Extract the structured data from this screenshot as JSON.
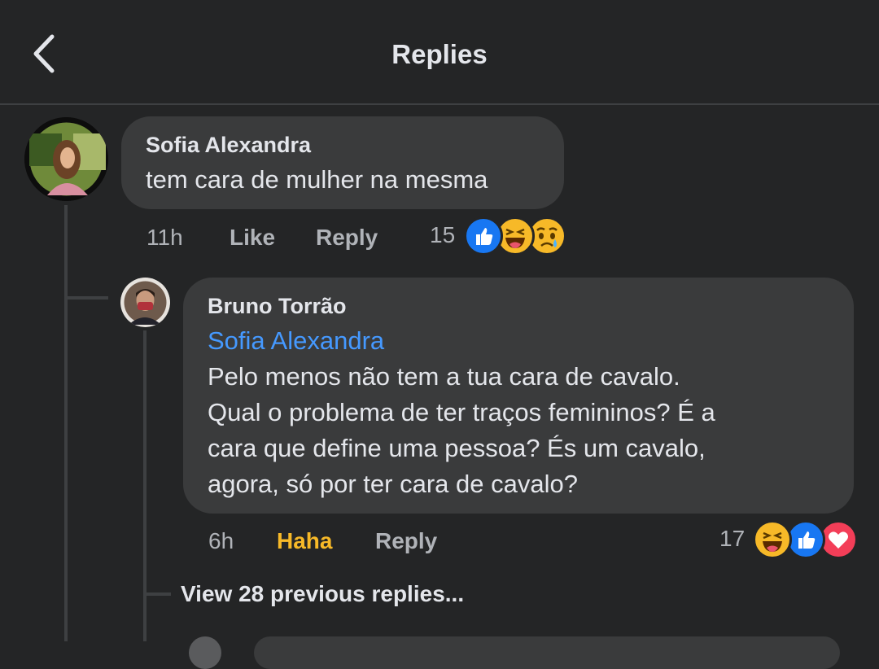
{
  "header": {
    "title": "Replies"
  },
  "comment": {
    "author": "Sofia Alexandra",
    "text": "tem cara de mulher na mesma",
    "time": "11h",
    "like_label": "Like",
    "reply_label": "Reply",
    "reaction_count": "15",
    "reactions": [
      "like-icon",
      "haha-icon",
      "sad-icon"
    ]
  },
  "reply": {
    "author": "Bruno Torrão",
    "mention": "Sofia Alexandra",
    "lines": [
      "Pelo menos não tem a tua cara de cavalo.",
      "Qual o problema de ter traços femininos? É a",
      "cara que define uma pessoa? És um cavalo,",
      "agora, só por ter cara de cavalo?"
    ],
    "time": "6h",
    "reaction_label": "Haha",
    "reply_label": "Reply",
    "reaction_count": "17",
    "reactions": [
      "haha-icon",
      "like-icon",
      "love-icon"
    ]
  },
  "view_previous": "View 28 previous replies...",
  "colors": {
    "background": "#242526",
    "bubble": "#3a3b3c",
    "mention": "#4599ff",
    "haha_active": "#f7b928",
    "like_blue": "#1877f2",
    "love_red": "#f33e58"
  }
}
